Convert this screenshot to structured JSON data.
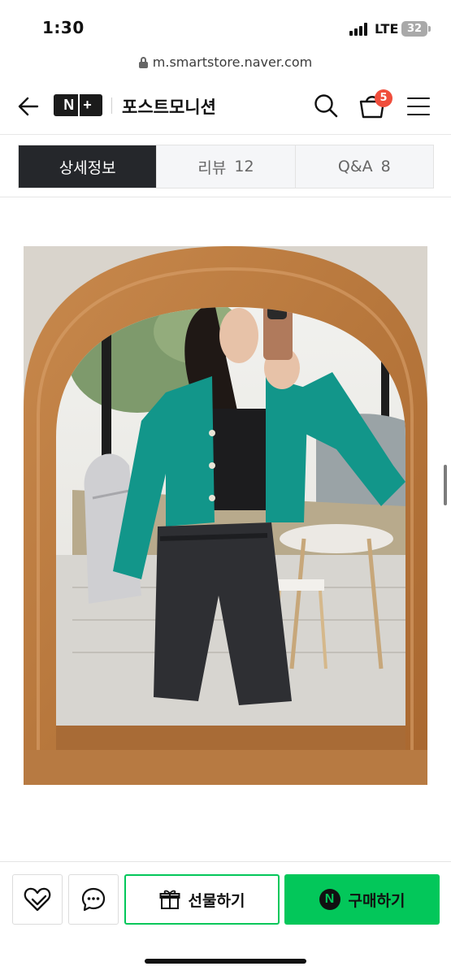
{
  "status_bar": {
    "time": "1:30",
    "network": "LTE",
    "battery": "32"
  },
  "browser": {
    "url": "m.smartstore.naver.com"
  },
  "header": {
    "logo_left": "N",
    "logo_right": "+",
    "store_name": "포스트모니션",
    "cart_count": "5"
  },
  "tabs": [
    {
      "label": "상세정보",
      "count": "",
      "active": true
    },
    {
      "label": "리뷰",
      "count": "12",
      "active": false
    },
    {
      "label": "Q&A",
      "count": "8",
      "active": false
    }
  ],
  "bottom_bar": {
    "gift_label": "선물하기",
    "buy_label": "구매하기",
    "npay_mark": "N"
  },
  "colors": {
    "naver_green": "#03c75a",
    "badge_red": "#f04e3c",
    "active_tab": "#25272b",
    "jacket_teal": "#12968a"
  },
  "icons": {
    "back": "arrow-left-icon",
    "search": "search-icon",
    "cart": "shopping-bag-icon",
    "menu": "hamburger-menu-icon",
    "wishlist": "heart-icon",
    "chat": "chat-bubble-icon",
    "gift": "gift-box-icon"
  }
}
